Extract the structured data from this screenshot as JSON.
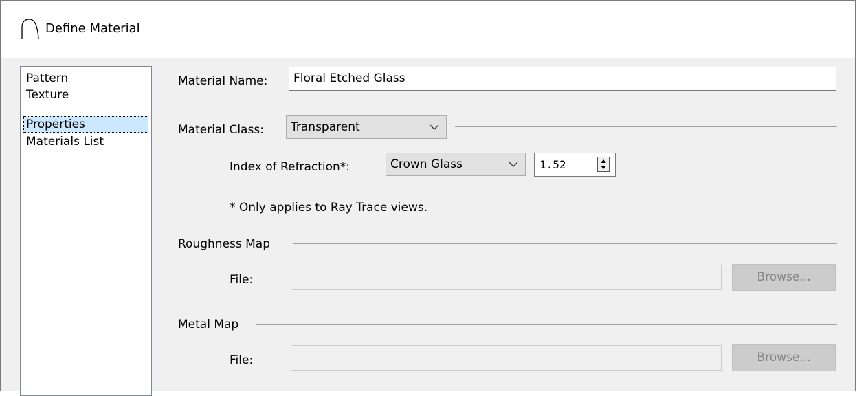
{
  "window": {
    "title": "Define Material",
    "icon": "arch-icon"
  },
  "nav": {
    "items": [
      {
        "label": "Pattern"
      },
      {
        "label": "Texture"
      },
      {
        "label": "Properties",
        "selected": true
      },
      {
        "label": "Materials List"
      }
    ]
  },
  "material_name": {
    "label": "Material Name:",
    "value": "Floral Etched Glass"
  },
  "material_class": {
    "label": "Material Class:",
    "selected": "Transparent"
  },
  "refraction": {
    "label": "Index of Refraction*:",
    "preset": "Crown Glass",
    "value": "1.52",
    "note": "* Only applies to Ray Trace views."
  },
  "roughness_map": {
    "group_label": "Roughness Map",
    "file_label": "File:",
    "file_value": "",
    "browse_label": "Browse..."
  },
  "metal_map": {
    "group_label": "Metal Map",
    "file_label": "File:",
    "file_value": "",
    "browse_label": "Browse..."
  },
  "colors": {
    "selection": "#cce8ff",
    "disabled_button": "#cccccc",
    "disabled_text": "#838383"
  }
}
